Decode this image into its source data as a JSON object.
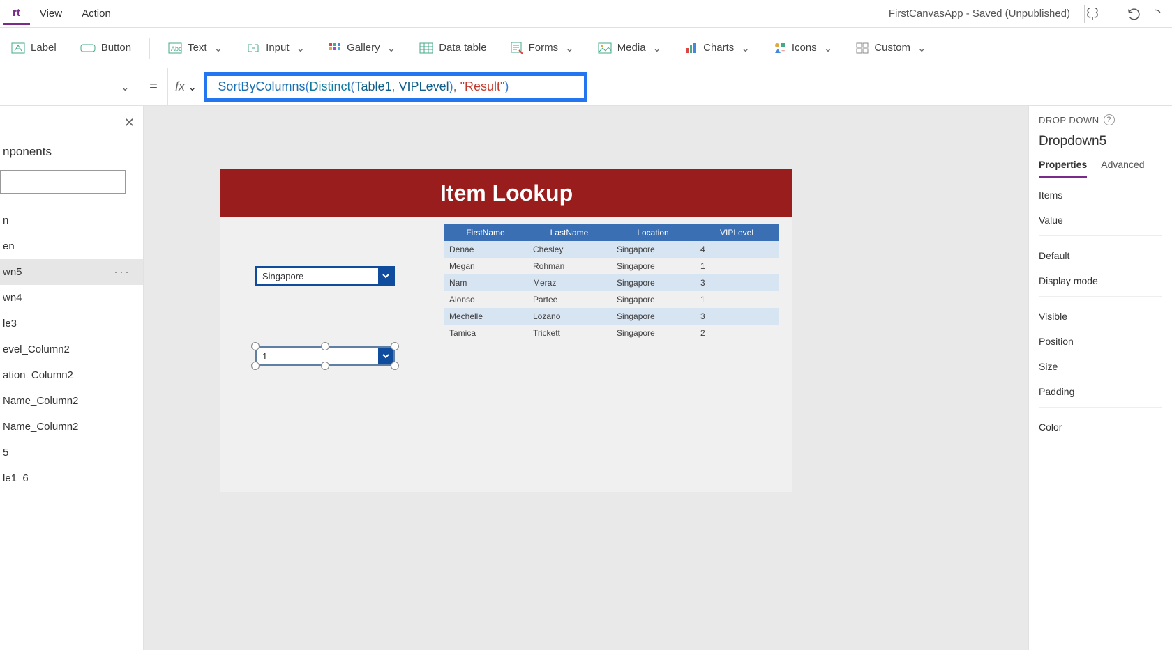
{
  "header": {
    "menus": [
      "rt",
      "View",
      "Action"
    ],
    "app_title": "FirstCanvasApp - Saved (Unpublished)"
  },
  "ribbon": {
    "label": "Label",
    "button": "Button",
    "text": "Text",
    "input": "Input",
    "gallery": "Gallery",
    "datatable": "Data table",
    "forms": "Forms",
    "media": "Media",
    "charts": "Charts",
    "icons": "Icons",
    "custom": "Custom"
  },
  "formula": {
    "tokens": {
      "fn1": "SortByColumns",
      "fn2": "Distinct",
      "arg1": "Table1",
      "arg2": "VIPLevel",
      "str": "\"Result\""
    }
  },
  "tree": {
    "heading": "nponents",
    "items": [
      "n",
      "en",
      "wn5",
      "wn4",
      "le3",
      "evel_Column2",
      "ation_Column2",
      "Name_Column2",
      "Name_Column2",
      "5",
      "le1_6"
    ],
    "selected_index": 2
  },
  "canvas": {
    "title": "Item Lookup",
    "dropdown1_value": "Singapore",
    "dropdown2_value": "1",
    "table": {
      "headers": [
        "FirstName",
        "LastName",
        "Location",
        "VIPLevel"
      ],
      "rows": [
        [
          "Denae",
          "Chesley",
          "Singapore",
          "4"
        ],
        [
          "Megan",
          "Rohman",
          "Singapore",
          "1"
        ],
        [
          "Nam",
          "Meraz",
          "Singapore",
          "3"
        ],
        [
          "Alonso",
          "Partee",
          "Singapore",
          "1"
        ],
        [
          "Mechelle",
          "Lozano",
          "Singapore",
          "3"
        ],
        [
          "Tamica",
          "Trickett",
          "Singapore",
          "2"
        ]
      ]
    }
  },
  "props": {
    "section": "DROP DOWN",
    "control_name": "Dropdown5",
    "tabs": [
      "Properties",
      "Advanced"
    ],
    "rows_group1": [
      "Items",
      "Value"
    ],
    "rows_group2": [
      "Default",
      "Display mode"
    ],
    "rows_group3": [
      "Visible",
      "Position",
      "Size",
      "Padding"
    ],
    "rows_group4": [
      "Color"
    ]
  }
}
